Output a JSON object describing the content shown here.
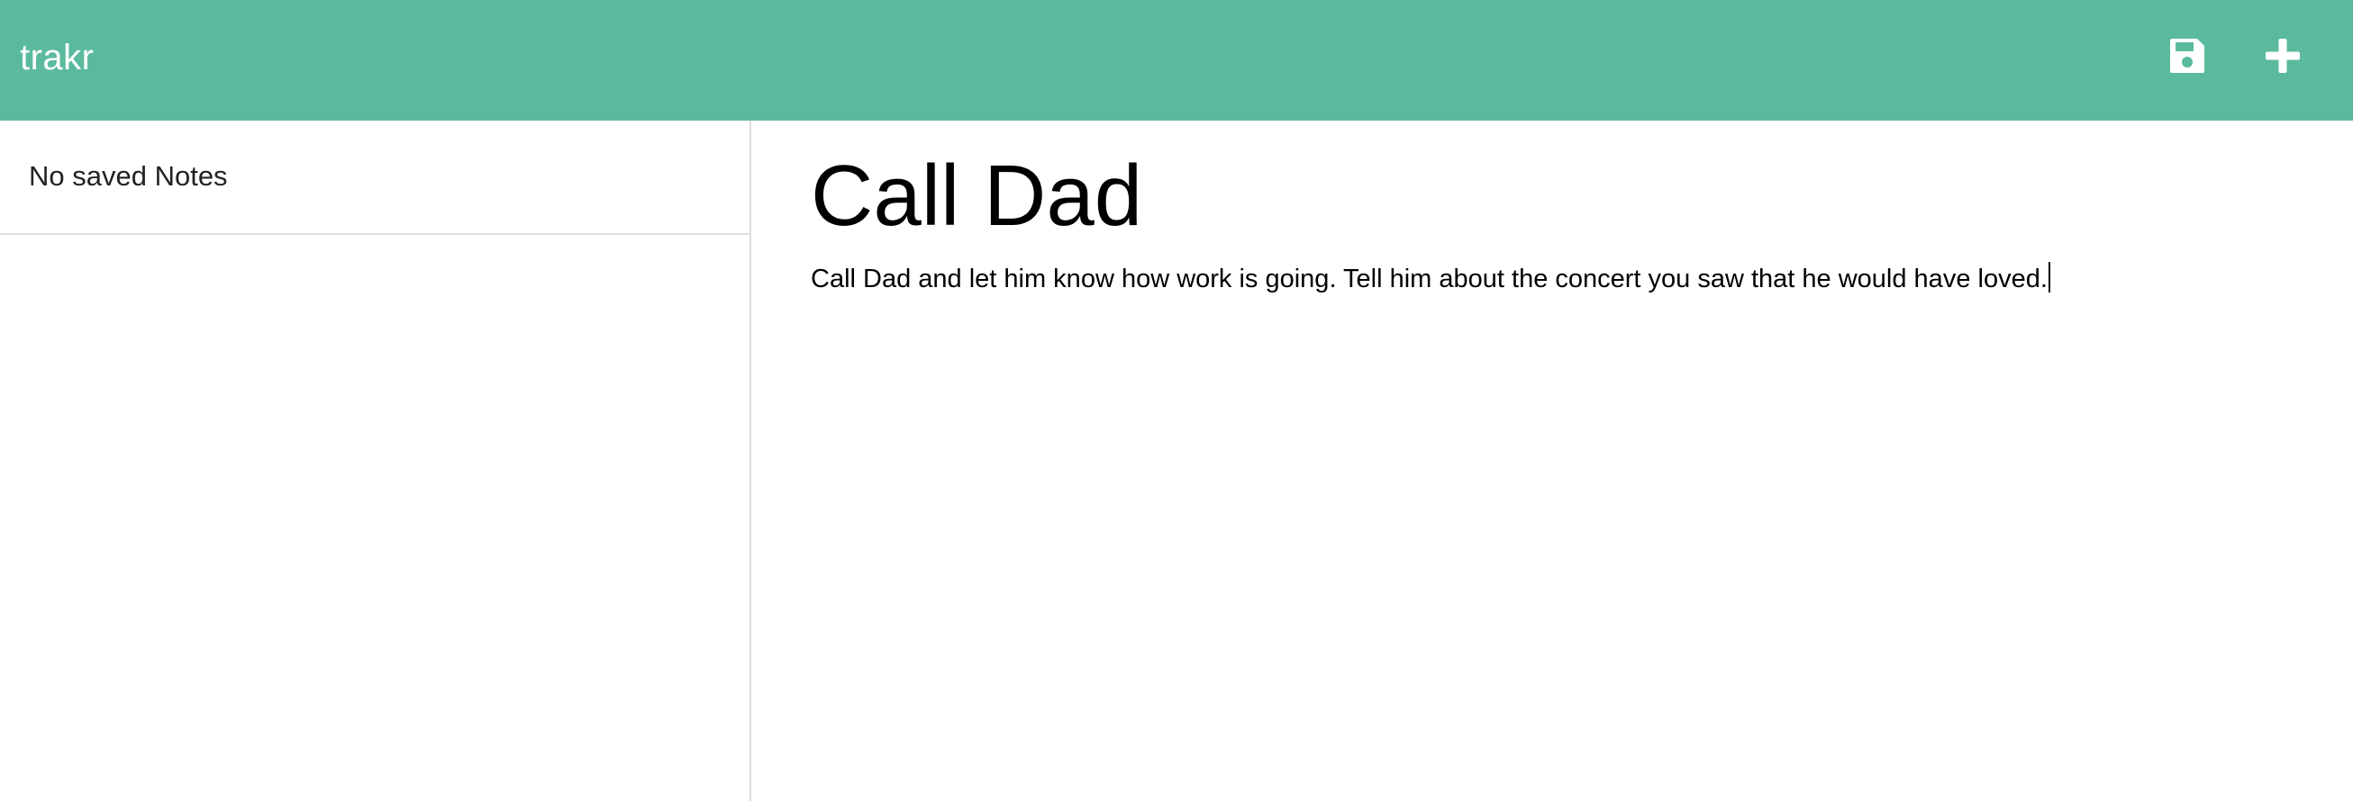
{
  "header": {
    "brand": "trakr",
    "save_icon": "floppy-disk-icon",
    "add_icon": "plus-icon",
    "background_color": "#5bba9e",
    "icon_color": "#ffffff"
  },
  "sidebar": {
    "items": [
      {
        "label": "No saved Notes"
      }
    ]
  },
  "editor": {
    "title": "Call Dad",
    "body": "Call Dad and let him know how work is going. Tell him about the concert you saw that he would have loved."
  }
}
